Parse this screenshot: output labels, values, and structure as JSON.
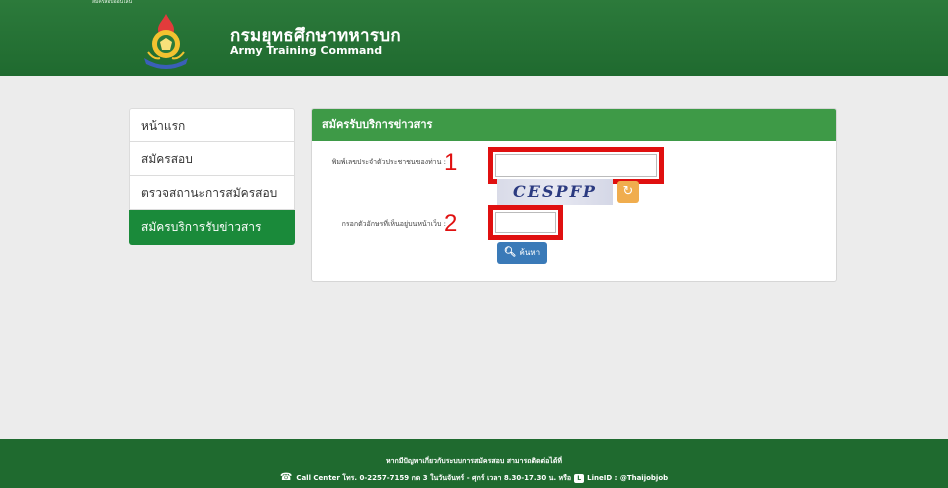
{
  "header": {
    "top_strip": "สมัครสอบออนไลน์",
    "title_th": "กรมยุทธศึกษาทหารบก",
    "title_en": "Army Training Command",
    "logo_icon": "army-emblem-icon"
  },
  "sidebar": {
    "items": [
      {
        "label": "หน้าแรก"
      },
      {
        "label": "สมัครสอบ"
      },
      {
        "label": "ตรวจสถานะการสมัครสอบ"
      },
      {
        "label": "สมัครบริการรับข่าวสาร"
      }
    ],
    "active_index": 3
  },
  "panel": {
    "title": "สมัครรับบริการข่าวสาร",
    "id_label": "พิมพ์เลขประจำตัวประชาชนของท่าน :",
    "id_value": "",
    "annotation_1": "1",
    "captcha_text": "CESPFP",
    "refresh_icon": "refresh-icon",
    "captcha_label": "กรอกตัวอักษรที่เห็นอยู่บนหน้าเว็บ :",
    "captcha_value": "",
    "annotation_2": "2",
    "search_label": "ค้นหา",
    "search_icon": "search-icon"
  },
  "footer": {
    "line1": "หากมีปัญหาเกี่ยวกับระบบการสมัครสอบ สามารถติดต่อได้ที่",
    "line2_a": "Call Center โทร. 0-2257-7159 กด 3 ในวันจันทร์ - ศุกร์ เวลา 8.30-17.30 น. หรือ",
    "line2_b": "LineID : @Thaijobjob"
  },
  "colors": {
    "header_green": "#1f6a2f",
    "panel_head_green": "#3e9a47",
    "active_green": "#1a8a3a",
    "annotation_red": "#e01010",
    "refresh_orange": "#f0ad4e",
    "button_blue": "#3a7ab8"
  }
}
